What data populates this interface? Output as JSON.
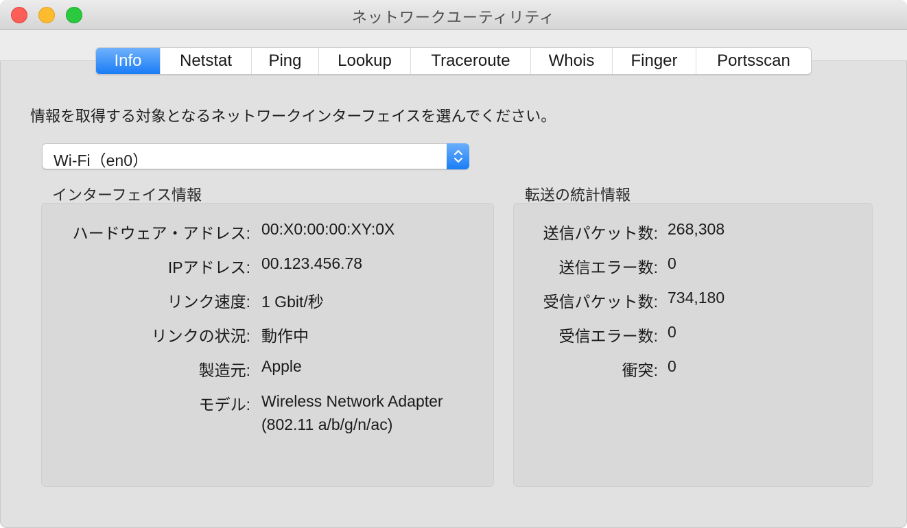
{
  "window": {
    "title": "ネットワークユーティリティ",
    "traffic_lights": {
      "close": "#fc5f57",
      "minimize": "#fdbc2e",
      "maximize": "#2ac940"
    }
  },
  "tabs": [
    {
      "label": "Info",
      "active": true
    },
    {
      "label": "Netstat",
      "active": false
    },
    {
      "label": "Ping",
      "active": false
    },
    {
      "label": "Lookup",
      "active": false
    },
    {
      "label": "Traceroute",
      "active": false
    },
    {
      "label": "Whois",
      "active": false
    },
    {
      "label": "Finger",
      "active": false
    },
    {
      "label": "Portsscan",
      "active": false
    }
  ],
  "accent_color": "#1a7cf6",
  "instruction": "情報を取得する対象となるネットワークインターフェイスを選んでください。",
  "interface_select": {
    "value": "Wi-Fi（en0）",
    "icon": "up-down-chevron-icon"
  },
  "interface_info": {
    "title": "インターフェイス情報",
    "rows": [
      {
        "label": "ハードウェア・アドレス:",
        "value": "00:X0:00:00:XY:0X"
      },
      {
        "label": "IPアドレス:",
        "value": "00.123.456.78"
      },
      {
        "label": "リンク速度:",
        "value": "1 Gbit/秒"
      },
      {
        "label": "リンクの状況:",
        "value": "動作中"
      },
      {
        "label": "製造元:",
        "value": "Apple"
      },
      {
        "label": "モデル:",
        "value": "Wireless Network Adapter (802.11 a/b/g/n/ac)"
      }
    ]
  },
  "transfer_stats": {
    "title": "転送の統計情報",
    "rows": [
      {
        "label": "送信パケット数:",
        "value": "268,308"
      },
      {
        "label": "送信エラー数:",
        "value": "0"
      },
      {
        "label": "受信パケット数:",
        "value": "734,180"
      },
      {
        "label": "受信エラー数:",
        "value": "0"
      },
      {
        "label": "衝突:",
        "value": "0"
      }
    ]
  }
}
